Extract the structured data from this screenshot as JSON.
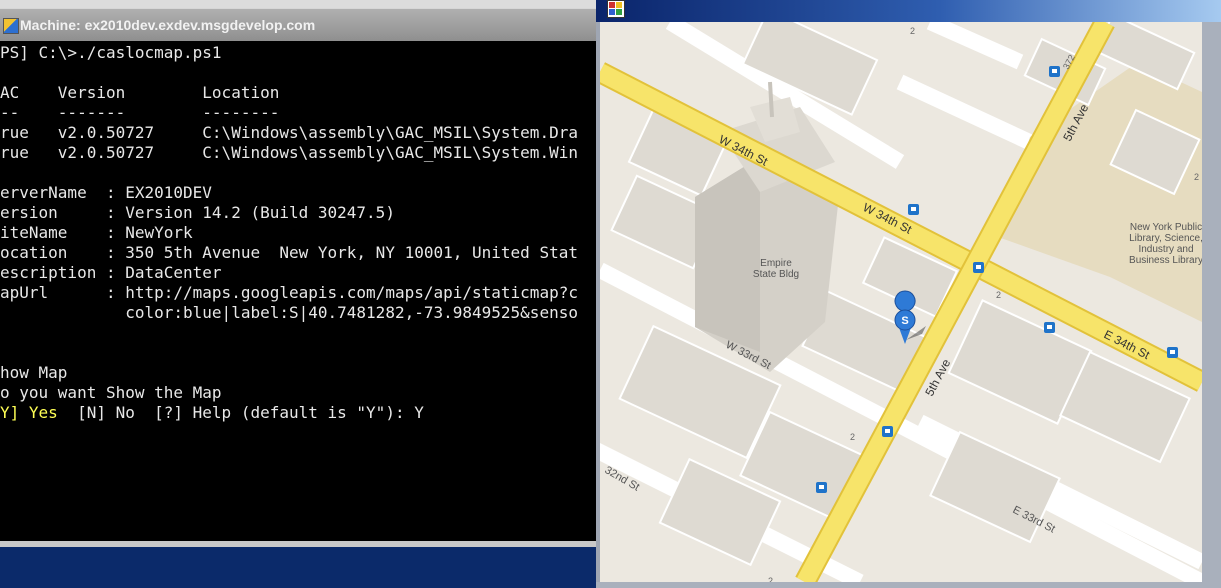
{
  "console": {
    "title": "Machine: ex2010dev.exdev.msgdevelop.com",
    "lines": [
      "PS] C:\\>./caslocmap.ps1",
      "",
      "AC    Version        Location",
      "--    -------        --------",
      "rue   v2.0.50727     C:\\Windows\\assembly\\GAC_MSIL\\System.Dra",
      "rue   v2.0.50727     C:\\Windows\\assembly\\GAC_MSIL\\System.Win",
      "",
      "erverName  : EX2010DEV",
      "ersion     : Version 14.2 (Build 30247.5)",
      "iteName    : NewYork",
      "ocation    : 350 5th Avenue  New York, NY 10001, United Stat",
      "escription : DataCenter",
      "apUrl      : http://maps.googleapis.com/maps/api/staticmap?c",
      "             color:blue|label:S|40.7481282,-73.9849525&senso",
      "",
      "",
      "how Map",
      "o you want Show the Map"
    ],
    "prompt": {
      "yes_option": "Y] Yes",
      "rest": "  [N] No  [?] Help (default is \"Y\"): Y"
    }
  },
  "map": {
    "streets": {
      "w34_upper": "W 34th St",
      "w34_lower": "W 34th St",
      "fifth_upper": "5th Ave",
      "fifth_lower": "5th Ave",
      "e34": "E 34th St",
      "w33": "W 33rd St",
      "w32": "32nd St",
      "e33": "E 33rd St"
    },
    "places": {
      "empire_line1": "Empire",
      "empire_line2": "State Bldg",
      "library_line1": "New York Public",
      "library_line2": "Library, Science,",
      "library_line3": "Industry and",
      "library_line4": "Business Library"
    },
    "marker_label": "S",
    "numbers": [
      "2",
      "372",
      "2",
      "2",
      "2",
      "2"
    ],
    "colors": {
      "road": "#f7e46a",
      "road_edge": "#e2c23a",
      "marker": "#2e7ad6",
      "transit": "#1f73c9"
    }
  }
}
